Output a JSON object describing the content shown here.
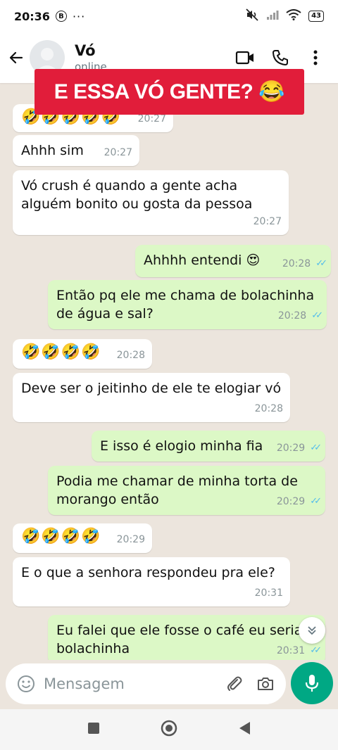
{
  "status_bar": {
    "time": "20:36",
    "b_icon_label": "B",
    "more": "···",
    "battery": "43"
  },
  "header": {
    "contact_name": "Vó",
    "contact_status": "online"
  },
  "banner": {
    "text": "E ESSA VÓ GENTE?",
    "emoji": "😂"
  },
  "messages": [
    {
      "dir": "in",
      "text": "🤣🤣🤣🤣🤣",
      "time": "20:27"
    },
    {
      "dir": "in",
      "text": "Ahhh sim",
      "time": "20:27"
    },
    {
      "dir": "in",
      "text": "Vó crush é quando a gente acha alguém bonito ou gosta da pessoa",
      "time": "20:27"
    },
    {
      "dir": "out",
      "text": "Ahhhh entendi 😍",
      "time": "20:28"
    },
    {
      "dir": "out",
      "text": "Então pq ele me chama de bolachinha de água e sal?",
      "time": "20:28"
    },
    {
      "dir": "in",
      "text": "🤣🤣🤣🤣",
      "time": "20:28"
    },
    {
      "dir": "in",
      "text": "Deve ser o jeitinho de ele te elogiar vó",
      "time": "20:28"
    },
    {
      "dir": "out",
      "text": "E isso é elogio minha fia",
      "time": "20:29"
    },
    {
      "dir": "out",
      "text": "Podia me chamar de minha torta de morango então",
      "time": "20:29"
    },
    {
      "dir": "in",
      "text": "🤣🤣🤣🤣",
      "time": "20:29"
    },
    {
      "dir": "in",
      "text": "E o que a senhora respondeu pra ele?",
      "time": "20:31"
    },
    {
      "dir": "out",
      "text": "Eu falei que ele fosse o café eu seria a bolachinha",
      "time": "20:31"
    }
  ],
  "composer": {
    "placeholder": "Mensagem"
  },
  "colors": {
    "incoming_bubble": "#ffffff",
    "outgoing_bubble": "#dcf8c6",
    "chat_background": "#ece5dd",
    "accent": "#00a884",
    "banner": "#e11d3a",
    "read_ticks": "#53bdeb"
  },
  "icons": {
    "back": "arrow-left-icon",
    "video": "video-camera-icon",
    "call": "phone-icon",
    "menu": "kebab-menu-icon",
    "emoji": "emoji-icon",
    "attach": "paperclip-icon",
    "camera": "camera-icon",
    "mic": "microphone-icon",
    "scroll": "double-chevron-down-icon"
  }
}
